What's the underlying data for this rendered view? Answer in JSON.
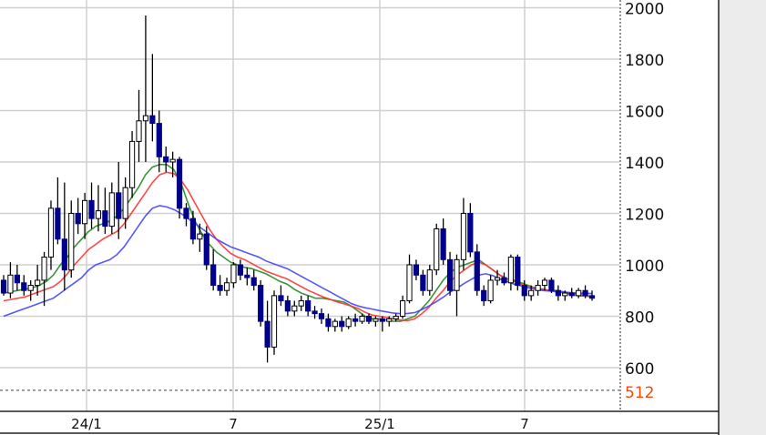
{
  "chart_data": {
    "type": "candlestick",
    "title": "",
    "xlabel": "",
    "ylabel": "",
    "ylim": [
      430,
      2030
    ],
    "y_ticks": [
      2000,
      1800,
      1600,
      1400,
      1200,
      1000,
      800,
      600
    ],
    "x_ticks": [
      "24/1",
      "7",
      "25/1",
      "7"
    ],
    "reference_line": {
      "value": 512,
      "label": "512",
      "color": "#ff4400"
    },
    "grid": true,
    "colors": {
      "grid": "#d0d0d0",
      "up_candle": "#ffffff",
      "down_candle": "#00008b",
      "wick": "#000000",
      "ma_short": "#228b22",
      "ma_mid": "#ff3333",
      "ma_long": "#4444ff",
      "right_panel": "#ececec"
    },
    "moving_averages": [
      {
        "values": [
          890,
          895,
          900,
          905,
          910,
          920,
          935,
          960,
          1000,
          1030,
          1070,
          1100,
          1130,
          1150,
          1160,
          1170,
          1190,
          1220,
          1260,
          1300,
          1350,
          1380,
          1390,
          1390,
          1370,
          1320,
          1240,
          1170,
          1120,
          1080,
          1050,
          1030,
          1010,
          1000,
          990,
          985,
          975,
          965,
          950,
          935,
          925,
          905,
          890,
          880,
          870,
          870,
          865,
          860,
          855,
          840,
          820,
          800,
          790,
          790,
          785,
          780,
          780,
          790,
          800,
          830,
          860,
          900,
          940,
          970,
          990,
          1000,
          1010,
          1020,
          1000,
          980,
          960,
          945,
          940,
          930,
          920,
          910,
          905,
          900,
          900,
          895,
          890,
          885,
          880,
          878
        ]
      },
      {
        "values": [
          860,
          865,
          870,
          875,
          885,
          895,
          905,
          915,
          935,
          965,
          1000,
          1030,
          1060,
          1080,
          1100,
          1115,
          1130,
          1160,
          1200,
          1240,
          1280,
          1320,
          1350,
          1360,
          1355,
          1330,
          1290,
          1240,
          1190,
          1140,
          1100,
          1070,
          1045,
          1030,
          1020,
          1005,
          990,
          975,
          965,
          955,
          945,
          930,
          915,
          900,
          888,
          876,
          866,
          856,
          848,
          840,
          830,
          815,
          805,
          800,
          795,
          790,
          785,
          783,
          790,
          810,
          835,
          870,
          900,
          935,
          960,
          980,
          1000,
          1010,
          1000,
          980,
          960,
          945,
          935,
          925,
          915,
          910,
          905,
          900,
          895,
          890,
          885,
          880,
          878,
          876
        ]
      },
      {
        "values": [
          800,
          810,
          820,
          830,
          840,
          850,
          860,
          870,
          890,
          910,
          930,
          950,
          980,
          1000,
          1010,
          1020,
          1040,
          1070,
          1110,
          1150,
          1190,
          1220,
          1230,
          1225,
          1215,
          1200,
          1180,
          1160,
          1140,
          1120,
          1100,
          1085,
          1070,
          1060,
          1050,
          1040,
          1030,
          1015,
          1005,
          995,
          985,
          970,
          955,
          940,
          925,
          910,
          895,
          880,
          865,
          850,
          840,
          833,
          828,
          822,
          817,
          812,
          810,
          811,
          814,
          826,
          840,
          856,
          874,
          894,
          910,
          928,
          944,
          960,
          965,
          958,
          945,
          935,
          925,
          918,
          910,
          905,
          900,
          898,
          896,
          894,
          892,
          890,
          889,
          888
        ]
      }
    ],
    "candles": [
      {
        "o": 940,
        "h": 960,
        "l": 880,
        "c": 890
      },
      {
        "o": 890,
        "h": 1010,
        "l": 870,
        "c": 960
      },
      {
        "o": 960,
        "h": 1000,
        "l": 900,
        "c": 930
      },
      {
        "o": 930,
        "h": 960,
        "l": 880,
        "c": 900
      },
      {
        "o": 900,
        "h": 940,
        "l": 860,
        "c": 920
      },
      {
        "o": 920,
        "h": 1000,
        "l": 880,
        "c": 940
      },
      {
        "o": 940,
        "h": 1050,
        "l": 840,
        "c": 1030
      },
      {
        "o": 1030,
        "h": 1250,
        "l": 980,
        "c": 1220
      },
      {
        "o": 1220,
        "h": 1340,
        "l": 1080,
        "c": 1100
      },
      {
        "o": 1100,
        "h": 1320,
        "l": 900,
        "c": 980
      },
      {
        "o": 980,
        "h": 1250,
        "l": 950,
        "c": 1200
      },
      {
        "o": 1200,
        "h": 1260,
        "l": 1120,
        "c": 1160
      },
      {
        "o": 1160,
        "h": 1280,
        "l": 1100,
        "c": 1250
      },
      {
        "o": 1250,
        "h": 1320,
        "l": 1140,
        "c": 1180
      },
      {
        "o": 1180,
        "h": 1310,
        "l": 1130,
        "c": 1210
      },
      {
        "o": 1210,
        "h": 1300,
        "l": 1120,
        "c": 1150
      },
      {
        "o": 1150,
        "h": 1320,
        "l": 1120,
        "c": 1280
      },
      {
        "o": 1280,
        "h": 1400,
        "l": 1100,
        "c": 1180
      },
      {
        "o": 1180,
        "h": 1340,
        "l": 1140,
        "c": 1300
      },
      {
        "o": 1300,
        "h": 1520,
        "l": 1260,
        "c": 1480
      },
      {
        "o": 1480,
        "h": 1680,
        "l": 1400,
        "c": 1560
      },
      {
        "o": 1560,
        "h": 1970,
        "l": 1400,
        "c": 1580
      },
      {
        "o": 1580,
        "h": 1820,
        "l": 1480,
        "c": 1550
      },
      {
        "o": 1550,
        "h": 1600,
        "l": 1360,
        "c": 1420
      },
      {
        "o": 1420,
        "h": 1460,
        "l": 1360,
        "c": 1400
      },
      {
        "o": 1400,
        "h": 1440,
        "l": 1340,
        "c": 1410
      },
      {
        "o": 1410,
        "h": 1420,
        "l": 1180,
        "c": 1220
      },
      {
        "o": 1220,
        "h": 1240,
        "l": 1150,
        "c": 1180
      },
      {
        "o": 1180,
        "h": 1210,
        "l": 1080,
        "c": 1100
      },
      {
        "o": 1100,
        "h": 1160,
        "l": 1050,
        "c": 1120
      },
      {
        "o": 1120,
        "h": 1150,
        "l": 980,
        "c": 1000
      },
      {
        "o": 1000,
        "h": 1060,
        "l": 900,
        "c": 920
      },
      {
        "o": 920,
        "h": 960,
        "l": 880,
        "c": 900
      },
      {
        "o": 900,
        "h": 950,
        "l": 880,
        "c": 930
      },
      {
        "o": 930,
        "h": 1010,
        "l": 910,
        "c": 1000
      },
      {
        "o": 1000,
        "h": 1020,
        "l": 940,
        "c": 960
      },
      {
        "o": 960,
        "h": 990,
        "l": 920,
        "c": 950
      },
      {
        "o": 950,
        "h": 980,
        "l": 900,
        "c": 920
      },
      {
        "o": 920,
        "h": 940,
        "l": 760,
        "c": 780
      },
      {
        "o": 780,
        "h": 860,
        "l": 620,
        "c": 680
      },
      {
        "o": 680,
        "h": 900,
        "l": 650,
        "c": 880
      },
      {
        "o": 880,
        "h": 920,
        "l": 840,
        "c": 860
      },
      {
        "o": 860,
        "h": 880,
        "l": 800,
        "c": 820
      },
      {
        "o": 820,
        "h": 860,
        "l": 800,
        "c": 840
      },
      {
        "o": 840,
        "h": 880,
        "l": 820,
        "c": 860
      },
      {
        "o": 860,
        "h": 880,
        "l": 800,
        "c": 820
      },
      {
        "o": 820,
        "h": 840,
        "l": 790,
        "c": 810
      },
      {
        "o": 810,
        "h": 830,
        "l": 770,
        "c": 790
      },
      {
        "o": 790,
        "h": 810,
        "l": 740,
        "c": 760
      },
      {
        "o": 760,
        "h": 790,
        "l": 740,
        "c": 780
      },
      {
        "o": 780,
        "h": 800,
        "l": 740,
        "c": 760
      },
      {
        "o": 760,
        "h": 800,
        "l": 750,
        "c": 790
      },
      {
        "o": 790,
        "h": 810,
        "l": 760,
        "c": 780
      },
      {
        "o": 780,
        "h": 810,
        "l": 770,
        "c": 800
      },
      {
        "o": 800,
        "h": 810,
        "l": 770,
        "c": 780
      },
      {
        "o": 780,
        "h": 800,
        "l": 760,
        "c": 790
      },
      {
        "o": 790,
        "h": 800,
        "l": 740,
        "c": 780
      },
      {
        "o": 780,
        "h": 800,
        "l": 760,
        "c": 790
      },
      {
        "o": 790,
        "h": 810,
        "l": 780,
        "c": 800
      },
      {
        "o": 800,
        "h": 880,
        "l": 790,
        "c": 860
      },
      {
        "o": 860,
        "h": 1040,
        "l": 850,
        "c": 1000
      },
      {
        "o": 1000,
        "h": 1020,
        "l": 940,
        "c": 960
      },
      {
        "o": 960,
        "h": 980,
        "l": 880,
        "c": 900
      },
      {
        "o": 900,
        "h": 1000,
        "l": 880,
        "c": 980
      },
      {
        "o": 980,
        "h": 1160,
        "l": 960,
        "c": 1140
      },
      {
        "o": 1140,
        "h": 1180,
        "l": 1000,
        "c": 1020
      },
      {
        "o": 1020,
        "h": 1050,
        "l": 880,
        "c": 900
      },
      {
        "o": 900,
        "h": 1040,
        "l": 800,
        "c": 1020
      },
      {
        "o": 1020,
        "h": 1260,
        "l": 980,
        "c": 1200
      },
      {
        "o": 1200,
        "h": 1240,
        "l": 1030,
        "c": 1050
      },
      {
        "o": 1050,
        "h": 1080,
        "l": 880,
        "c": 900
      },
      {
        "o": 900,
        "h": 920,
        "l": 840,
        "c": 860
      },
      {
        "o": 860,
        "h": 960,
        "l": 850,
        "c": 940
      },
      {
        "o": 940,
        "h": 980,
        "l": 920,
        "c": 950
      },
      {
        "o": 950,
        "h": 970,
        "l": 920,
        "c": 930
      },
      {
        "o": 930,
        "h": 1040,
        "l": 900,
        "c": 1030
      },
      {
        "o": 1030,
        "h": 1040,
        "l": 900,
        "c": 920
      },
      {
        "o": 920,
        "h": 940,
        "l": 860,
        "c": 880
      },
      {
        "o": 880,
        "h": 920,
        "l": 860,
        "c": 900
      },
      {
        "o": 900,
        "h": 940,
        "l": 880,
        "c": 920
      },
      {
        "o": 920,
        "h": 950,
        "l": 900,
        "c": 940
      },
      {
        "o": 940,
        "h": 950,
        "l": 890,
        "c": 900
      },
      {
        "o": 900,
        "h": 920,
        "l": 860,
        "c": 880
      },
      {
        "o": 880,
        "h": 900,
        "l": 860,
        "c": 890
      },
      {
        "o": 890,
        "h": 910,
        "l": 870,
        "c": 880
      },
      {
        "o": 880,
        "h": 910,
        "l": 870,
        "c": 900
      },
      {
        "o": 900,
        "h": 920,
        "l": 870,
        "c": 880
      },
      {
        "o": 880,
        "h": 900,
        "l": 860,
        "c": 870
      }
    ]
  }
}
